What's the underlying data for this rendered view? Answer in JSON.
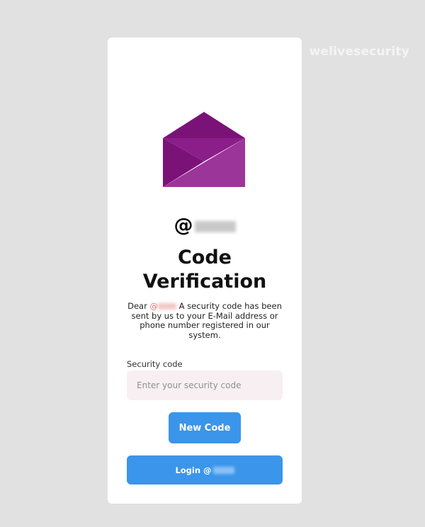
{
  "watermark": {
    "text": "welivesecurity"
  },
  "card": {
    "icon": "envelope-open-icon",
    "colors": {
      "envelope_dark": "#7a1278",
      "envelope_mid": "#8b1e89",
      "envelope_light": "#9c3599"
    },
    "username_prefix": "@",
    "title_line1": "Code",
    "title_line2": "Verification",
    "description": {
      "prefix": "Dear ",
      "name_at": "@",
      "body": " A security code has been sent by us to your E-Mail address or phone number registered in our system."
    },
    "form": {
      "label": "Security code",
      "placeholder": "Enter your security code",
      "value": ""
    },
    "new_code_button": "New Code",
    "login_button_prefix": "Login @",
    "accent_color": "#3b95ea"
  }
}
